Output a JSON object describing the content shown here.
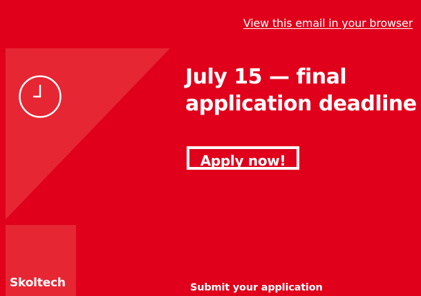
{
  "header": {
    "browser_link": "View this email in your browser"
  },
  "hero": {
    "icon": "clock-icon",
    "headline_line1": "July 15 — final",
    "headline_line2": "application deadline",
    "apply_label": "Apply now!"
  },
  "footer": {
    "logo_text": "Skoltech",
    "submit_text": "Submit your application"
  },
  "colors": {
    "background": "#e0001b",
    "panel": "#e82a38",
    "text": "#ffffff"
  }
}
